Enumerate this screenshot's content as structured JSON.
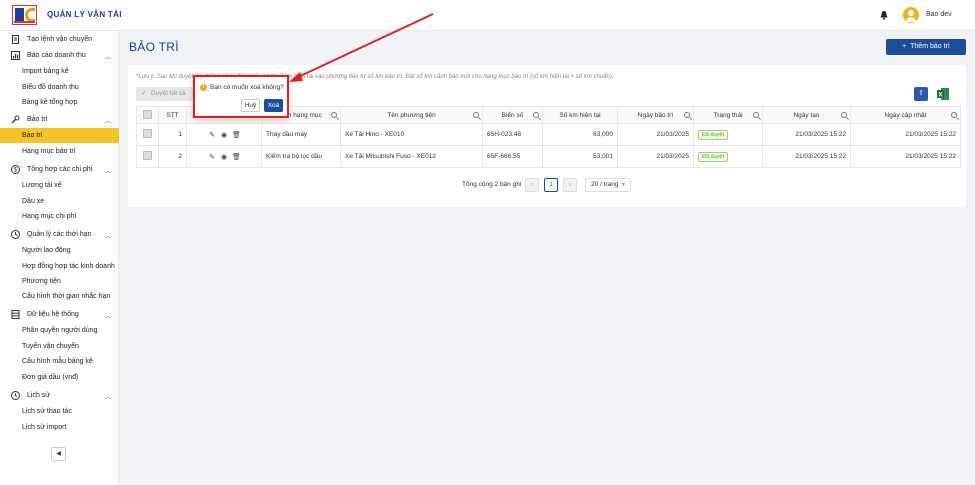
{
  "header": {
    "title": "QUẢN LÝ VẬN TẢI",
    "user": "Bao dev"
  },
  "sidebar": {
    "items": [
      {
        "label": "Tạo lệnh vận chuyển",
        "icon": "file-icon"
      },
      {
        "label": "Báo cáo doanh thu",
        "icon": "chart-icon",
        "children": [
          "Import bảng kê",
          "Biểu đồ doanh thu",
          "Bảng kê tổng hợp"
        ]
      },
      {
        "label": "Bảo trì",
        "icon": "wrench-icon",
        "children": [
          "Bảo trì",
          "Hạng mục bảo trì"
        ]
      },
      {
        "label": "Tổng hợp các chi phí",
        "icon": "dollar-icon",
        "children": [
          "Lương tài xế",
          "Dầu xe",
          "Hạng mục chi phí"
        ]
      },
      {
        "label": "Quản lý các thời hạn",
        "icon": "clock-icon",
        "children": [
          "Người lao động",
          "Hợp đồng hợp tác kinh doanh",
          "Phương tiện",
          "Cấu hình thời gian nhắc hạn"
        ]
      },
      {
        "label": "Dữ liệu hệ thống",
        "icon": "database-icon",
        "children": [
          "Phân quyền người dùng",
          "Tuyến vận chuyển",
          "Cấu hình mẫu bảng kê",
          "Đơn giá dầu (vnđ)"
        ]
      },
      {
        "label": "Lịch sử",
        "icon": "history-icon",
        "children": [
          "Lịch sử thao tác",
          "Lịch sử import"
        ]
      }
    ],
    "active": "Bảo trì"
  },
  "page": {
    "title": "BẢO TRÌ",
    "add_button": "Thêm bảo trì",
    "note": "*Lưu ý: Sau khi duyệt, hệ thống sẽ tự động cập nhật số km hiện tại vào phương tiện từ số km bảo trì. Đặt số km cảnh báo mới cho hạng mục bảo trì (số km hiện tại + số km chuẩn).",
    "approve_button": "Duyệt tất cả"
  },
  "table": {
    "columns": [
      "STT",
      "",
      "Tên hạng mục",
      "Tên phương tiện",
      "Biển số",
      "Số km hiện tại",
      "Ngày bảo trì",
      "Trạng thái",
      "Ngày tạo",
      "Ngày cập nhật"
    ],
    "rows": [
      {
        "stt": "1",
        "item": "Thay dầu máy",
        "vehicle": "Xe Tải Hino - XE010",
        "plate": "65H-023.48",
        "km": "63,000",
        "date": "21/03/2025",
        "status": "Đã duyệt",
        "created": "21/03/2025 15:22",
        "updated": "21/03/2025 15:22"
      },
      {
        "stt": "2",
        "item": "Kiểm tra bộ lọc dầu",
        "vehicle": "Xe Tải Mitsubishi Fuso - XE012",
        "plate": "65F-666.55",
        "km": "53,001",
        "date": "21/03/2025",
        "status": "Đã duyệt",
        "created": "21/03/2025 15:22",
        "updated": "21/03/2025 15:22"
      }
    ]
  },
  "pagination": {
    "total": "Tổng cộng 2 bản ghi",
    "current": "1",
    "page_size": "20 / trang"
  },
  "popconfirm": {
    "message": "Bạn có muốn xoá không?",
    "cancel": "Huỷ",
    "ok": "Xoá"
  },
  "colors": {
    "primary": "#1e4b9a",
    "active": "#f7c428",
    "annotation": "#e02020"
  }
}
